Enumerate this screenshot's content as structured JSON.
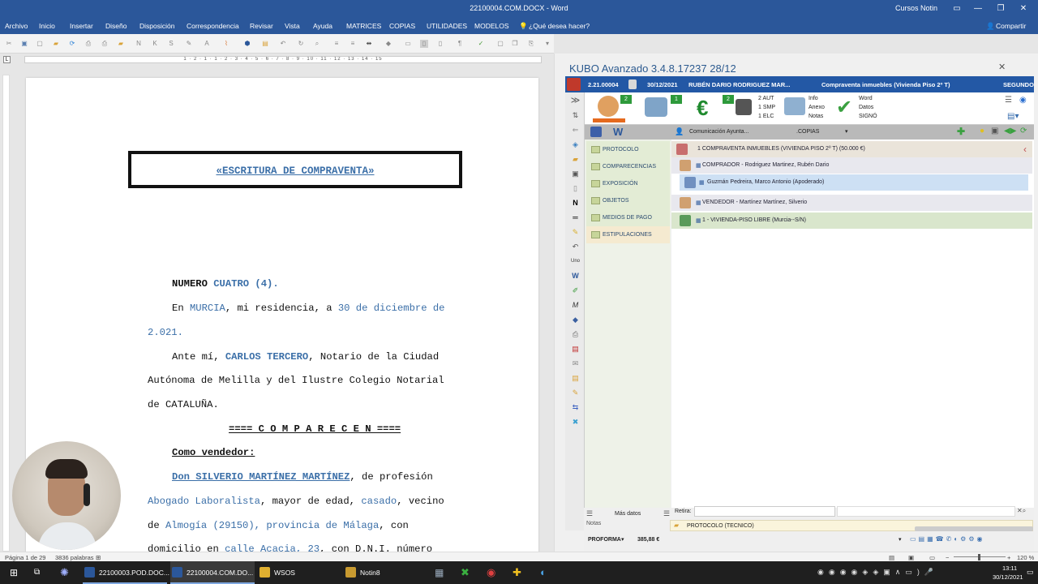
{
  "window": {
    "title": "22100004.COM.DOCX - Word",
    "user": "Cursos Notin",
    "minimize": "—",
    "restore": "❐",
    "close": "✕",
    "ribbon_options": "▭"
  },
  "menu": {
    "items": [
      "Archivo",
      "Inicio",
      "Insertar",
      "Diseño",
      "Disposición",
      "Correspondencia",
      "Revisar",
      "Vista",
      "Ayuda",
      "MATRICES",
      "COPIAS",
      "UTILIDADES",
      "MODELOS"
    ],
    "tell_me": "¿Qué desea hacer?",
    "share": "Compartir"
  },
  "ruler": {
    "text": "1 · 2 · 1 · 1 · 2 · 3 · 4 · 5 · 6 · 7 · 8 · 9 · 10 · 11 · 12 · 13 · 14 · 15"
  },
  "document": {
    "title": "«ESCRITURA DE COMPRAVENTA»",
    "numero_label": "NUMERO",
    "numero_value": "CUATRO (4).",
    "l_en": "En",
    "city": "MURCIA",
    "l_residencia": ", mi residencia, a",
    "date_a": "30 de diciembre de",
    "date_b": "2.021.",
    "l_ante": "Ante mí,",
    "notary": "CARLOS TERCERO",
    "l_notario": ", Notario de la Ciudad",
    "l_autonoma": "Autónoma de Melilla y del Ilustre Colegio Notarial",
    "l_cataluna": "de CATALUÑA.",
    "comparecen": "==== C O M P A R E C E N ====",
    "como_vendedor": "Como vendedor:",
    "seller": "Don  SILVERIO  MARTÍNEZ  MARTÍNEZ",
    "l_profesion": ", de profesión",
    "profession": "Abogado Laboralista",
    "l_mayor": ", mayor de edad,",
    "civil": "casado",
    "l_vecino": ", vecino",
    "l_de": "de",
    "town": "Almogía  (29150),",
    "province": "provincia  de  Málaga",
    "l_con": ",  con",
    "l_domicilio": "domicilio  en",
    "street": "calle  Acacia,  23",
    "l_dni": ", con  D.N.I.  número"
  },
  "word_status": {
    "page": "Página 1 de 29",
    "words": "3836 palabras",
    "zoom": "120 %"
  },
  "kubo": {
    "title": "KUBO Avanzado 3.4.8.17237   28/12",
    "header": {
      "code": "2.21.00004",
      "date": "30/12/2021",
      "person": "RUBÉN DARIO RODRIGUEZ MAR...",
      "subject": "Compraventa inmuebles (Vivienda Piso 2º T)",
      "status": "SEGUNDO"
    },
    "toolbar": {
      "badge_persons": "2",
      "badge_property": "1",
      "badge_money": "2",
      "print_lines": [
        "2 AUT",
        "1 SMP",
        "1 ELC"
      ],
      "info_lines": [
        "Info",
        "Anexo",
        "Notas"
      ],
      "word_lines": [
        "Word",
        "Datos",
        "SIGNÓ"
      ]
    },
    "subbar": {
      "comunicacion": "Comunicación Ayunta...",
      "copias": ".COPIAS"
    },
    "nav": [
      "PROTOCOLO",
      "COMPARECENCIAS",
      "EXPOSICIÓN",
      "OBJETOS",
      "MEDIOS DE PAGO",
      "ESTIPULACIONES"
    ],
    "tree": {
      "root": "1 COMPRAVENTA INMUEBLES (VIVIENDA PISO 2º T) (50.000 €)",
      "buyer": "COMPRADOR - Rodriguez Martinez, Rubén Dario",
      "attorney": "Guzmán Pedreira, Marco Antonio (Apoderado)",
      "seller": "VENDEDOR - Martínez Martínez, Silverio",
      "property": "1 - VIVIENDA-PISO LIBRE (Murcia--S/N)"
    },
    "bottom": {
      "mas_datos": "Más datos",
      "retira": "Retira:",
      "notas": "Notas",
      "protocolo": "PROTOCOLO (TECNICO)",
      "proforma": "PROFORMA",
      "amount": "385,88 €"
    }
  },
  "taskbar": {
    "items": [
      "22100003.POD.DOC...",
      "22100004.COM.DO...",
      "WSOS",
      "Notin8"
    ],
    "time": "13:11",
    "date": "30/12/2021"
  }
}
